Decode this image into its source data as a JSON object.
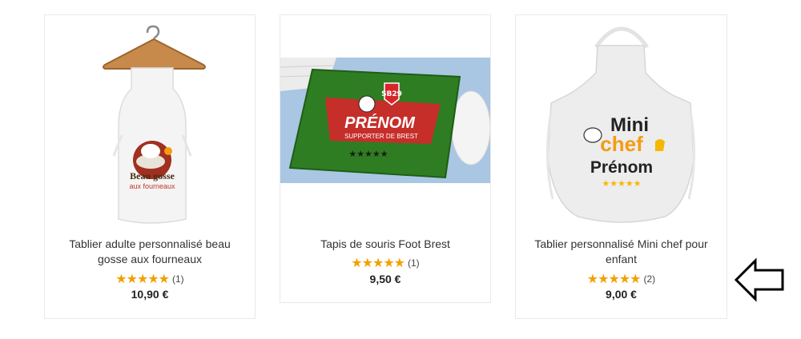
{
  "products": [
    {
      "title": "Tablier adulte personnalisé beau gosse aux fourneaux",
      "stars": "★★★★★",
      "review_count": "(1)",
      "price": "10,90 €",
      "rating": 5,
      "image_text": {
        "line1": "Beau gosse",
        "line2": "aux fourneaux"
      }
    },
    {
      "title": "Tapis de souris Foot Brest",
      "stars": "★★★★★",
      "review_count": "(1)",
      "price": "9,50 €",
      "rating": 5,
      "image_text": {
        "line1": "PRÉNOM",
        "line2": "SUPPORTER DE BREST",
        "badge": "SB29"
      }
    },
    {
      "title": "Tablier personnalisé Mini chef pour enfant",
      "stars": "★★★★★",
      "review_count": "(2)",
      "price": "9,00 €",
      "rating": 5,
      "image_text": {
        "line1": "Mini",
        "line2": "chef",
        "line3": "Prénom",
        "stars": "★★★★★"
      }
    }
  ],
  "colors": {
    "star": "#f2a100",
    "chef_orange": "#f39c12",
    "grass": "#3a8f2c",
    "brest_red": "#d7262b"
  },
  "icons": {
    "arrow": "arrow-left-outline-icon"
  }
}
